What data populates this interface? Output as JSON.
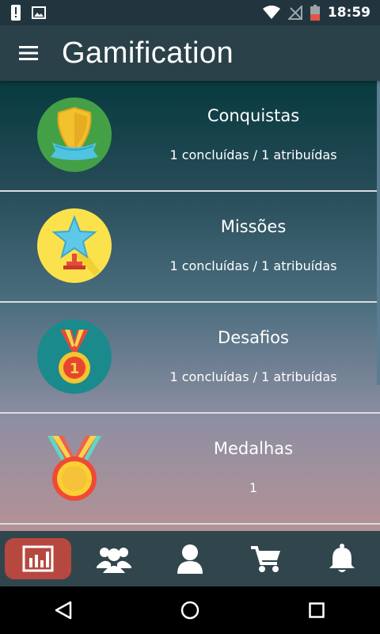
{
  "status_bar": {
    "time": "18:59",
    "icons": [
      "alert-icon",
      "image-icon",
      "wifi-icon",
      "no-signal-icon",
      "battery-icon"
    ]
  },
  "app_bar": {
    "title": "Gamification",
    "menu_icon": "hamburger-menu-icon"
  },
  "categories": [
    {
      "title": "Conquistas",
      "subtitle": "1 concluídas / 1 atribuídas",
      "icon": "shield-badge-icon"
    },
    {
      "title": "Missões",
      "subtitle": "1 concluídas / 1 atribuídas",
      "icon": "star-trophy-icon"
    },
    {
      "title": "Desafios",
      "subtitle": "1 concluídas / 1 atribuídas",
      "icon": "medal-number-icon",
      "icon_text": "1"
    },
    {
      "title": "Medalhas",
      "subtitle": "1",
      "icon": "gold-medal-icon"
    }
  ],
  "bottom_nav": {
    "items": [
      {
        "icon": "stats-chart-icon",
        "active": true
      },
      {
        "icon": "group-icon",
        "active": false
      },
      {
        "icon": "profile-icon",
        "active": false
      },
      {
        "icon": "cart-icon",
        "active": false
      },
      {
        "icon": "bell-icon",
        "active": false
      }
    ]
  },
  "system_nav": [
    "back-icon",
    "home-icon",
    "recents-icon"
  ],
  "colors": {
    "status_bar": "#22353f",
    "app_bar": "#2b4149",
    "bottom_nav": "#31454d",
    "active_tab": "#b7483f",
    "divider": "#d9dde0"
  }
}
